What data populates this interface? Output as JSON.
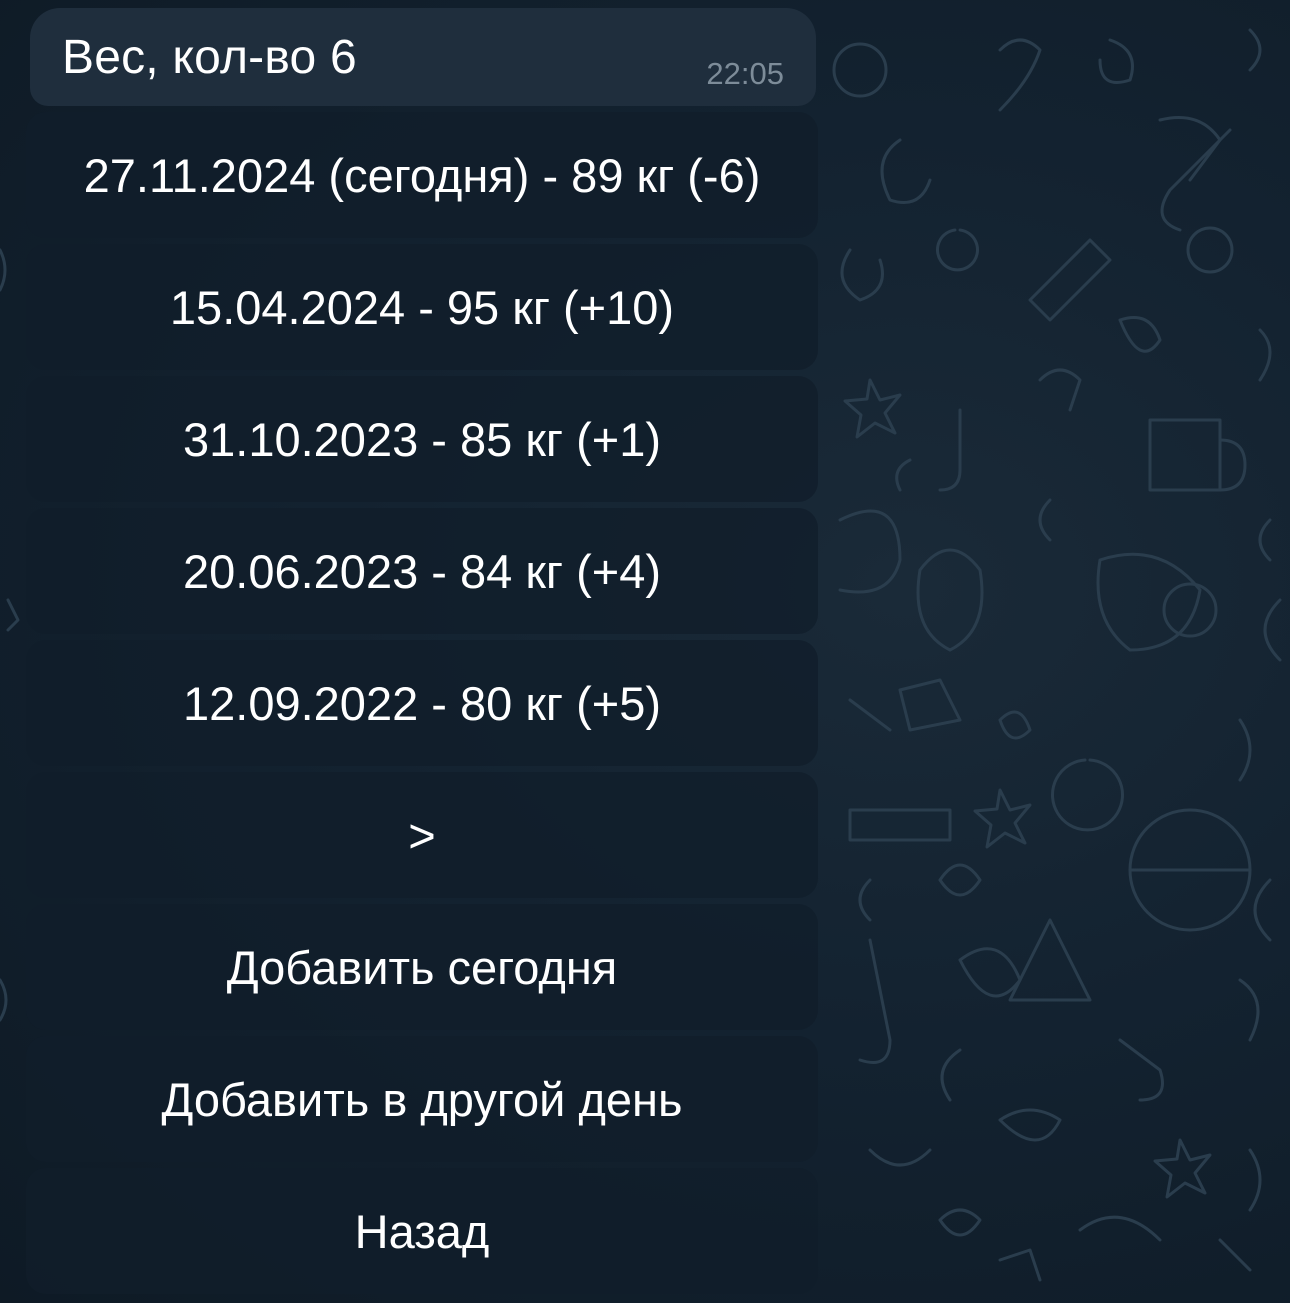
{
  "message": {
    "text": "Вес, кол-во 6",
    "time": "22:05"
  },
  "keyboard": {
    "entries": [
      "27.11.2024 (сегодня) - 89 кг (-6)",
      "15.04.2024 - 95 кг (+10)",
      "31.10.2023 - 85 кг (+1)",
      "20.06.2023 - 84 кг (+4)",
      "12.09.2022 - 80 кг (+5)"
    ],
    "next_label": ">",
    "add_today_label": "Добавить сегодня",
    "add_other_day_label": "Добавить в другой день",
    "back_label": "Назад"
  },
  "colors": {
    "background": "#0f1b26",
    "bubble": "#1f2e3d",
    "button": "#111e2a",
    "text": "#ffffff",
    "time": "#7d8c99"
  }
}
